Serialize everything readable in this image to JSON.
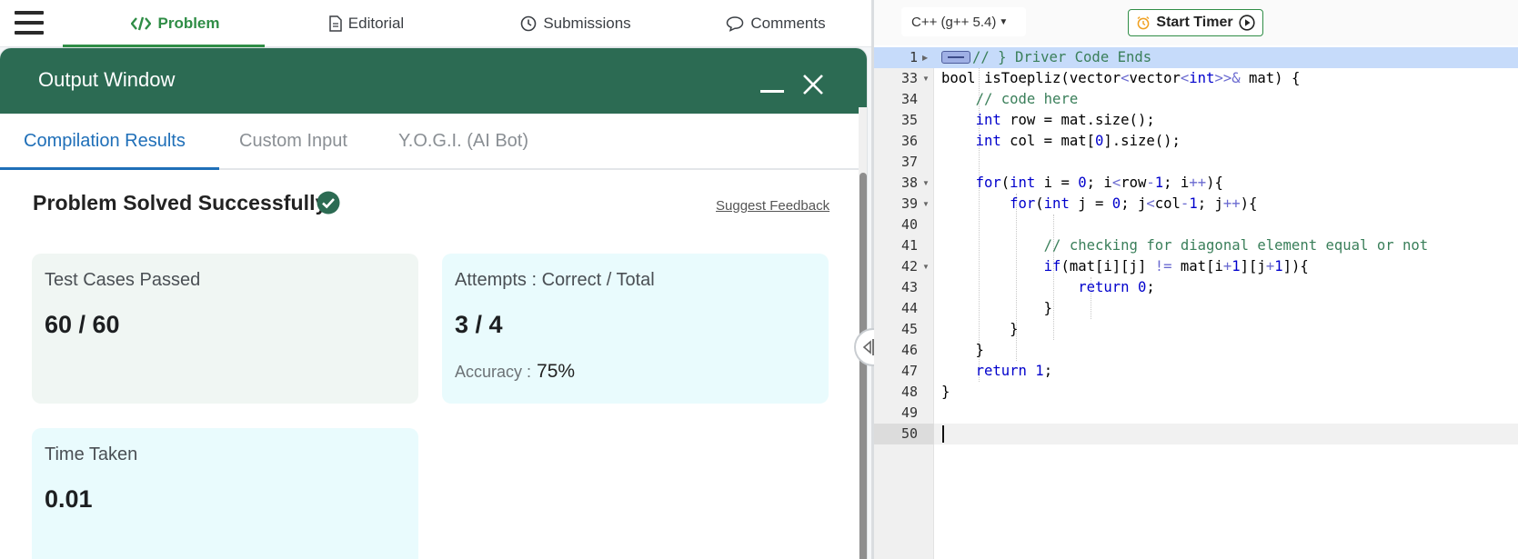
{
  "nav": {
    "tabs": [
      {
        "label": "Problem",
        "icon": "code-icon"
      },
      {
        "label": "Editorial",
        "icon": "document-icon"
      },
      {
        "label": "Submissions",
        "icon": "clock-icon"
      },
      {
        "label": "Comments",
        "icon": "chat-bubble-icon"
      }
    ],
    "active_tab": "Problem"
  },
  "output_window": {
    "title": "Output Window",
    "tabs": [
      "Compilation Results",
      "Custom Input",
      "Y.O.G.I. (AI Bot)"
    ],
    "active_tab": "Compilation Results",
    "status": "Problem Solved Successfully",
    "suggest_feedback": "Suggest Feedback",
    "cards": {
      "tests": {
        "label": "Test Cases Passed",
        "value": "60 / 60"
      },
      "attempts": {
        "label": "Attempts : Correct / Total",
        "value": "3 / 4",
        "accuracy_label": "Accuracy :",
        "accuracy_value": "75%"
      },
      "time": {
        "label": "Time Taken",
        "value": "0.01"
      }
    }
  },
  "editor": {
    "language": "C++ (g++ 5.4)",
    "start_timer": "Start Timer",
    "lines": [
      {
        "n": "1",
        "text": "// } Driver Code Ends"
      },
      {
        "n": "33",
        "text": "bool isToepliz(vector<vector<int>>& mat) {"
      },
      {
        "n": "34",
        "text": "    // code here"
      },
      {
        "n": "35",
        "text": "    int row = mat.size();"
      },
      {
        "n": "36",
        "text": "    int col = mat[0].size();"
      },
      {
        "n": "37",
        "text": ""
      },
      {
        "n": "38",
        "text": "    for(int i = 0; i<row-1; i++){"
      },
      {
        "n": "39",
        "text": "        for(int j = 0; j<col-1; j++){"
      },
      {
        "n": "40",
        "text": ""
      },
      {
        "n": "41",
        "text": "            // checking for diagonal element equal or not"
      },
      {
        "n": "42",
        "text": "            if(mat[i][j] != mat[i+1][j+1]){"
      },
      {
        "n": "43",
        "text": "                return 0;"
      },
      {
        "n": "44",
        "text": "            }"
      },
      {
        "n": "45",
        "text": "        }"
      },
      {
        "n": "46",
        "text": "    }"
      },
      {
        "n": "47",
        "text": "    return 1;"
      },
      {
        "n": "48",
        "text": "}"
      },
      {
        "n": "49",
        "text": ""
      },
      {
        "n": "50",
        "text": ""
      }
    ]
  },
  "colors": {
    "brand_green": "#2f8d46",
    "header_green": "#2c6b53",
    "active_blue": "#1f6fb8",
    "card_green": "#f0f6f3",
    "card_cyan": "#e9fbfd"
  }
}
